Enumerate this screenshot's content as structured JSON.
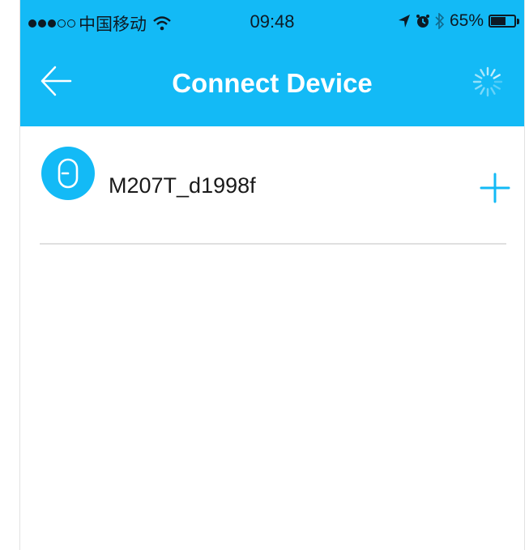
{
  "status_bar": {
    "carrier": "中国移动",
    "time": "09:48",
    "battery": "65%",
    "battery_level": 0.65
  },
  "nav": {
    "title": "Connect Device",
    "back_icon": "arrow-left-icon",
    "loading_icon": "spinner-icon"
  },
  "devices": [
    {
      "name": "M207T_d1998f",
      "icon": "lock-device-icon",
      "action_icon": "plus-icon"
    }
  ],
  "colors": {
    "accent": "#13baf6",
    "divider": "#e0e0e0"
  }
}
